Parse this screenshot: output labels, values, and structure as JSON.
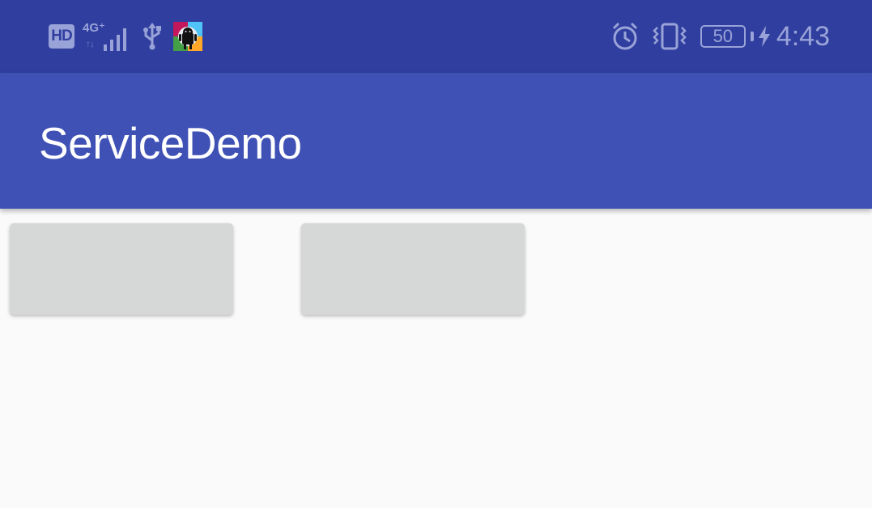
{
  "status_bar": {
    "hd_label": "HD",
    "network_type": "4G⁺",
    "network_arrows": "↑↓",
    "battery_level": "50",
    "time": "4:43",
    "icons": [
      "hd-icon",
      "signal-icon",
      "usb-icon",
      "app-notification-icon",
      "alarm-icon",
      "vibrate-icon",
      "battery-icon",
      "charging-bolt-icon"
    ]
  },
  "app_bar": {
    "title": "ServiceDemo"
  },
  "main": {
    "buttons": [
      {
        "label": ""
      },
      {
        "label": ""
      }
    ]
  },
  "colors": {
    "status_bar": "#303f9f",
    "app_bar": "#3f51b5",
    "background": "#fafafa",
    "button": "#d6d7d7"
  }
}
